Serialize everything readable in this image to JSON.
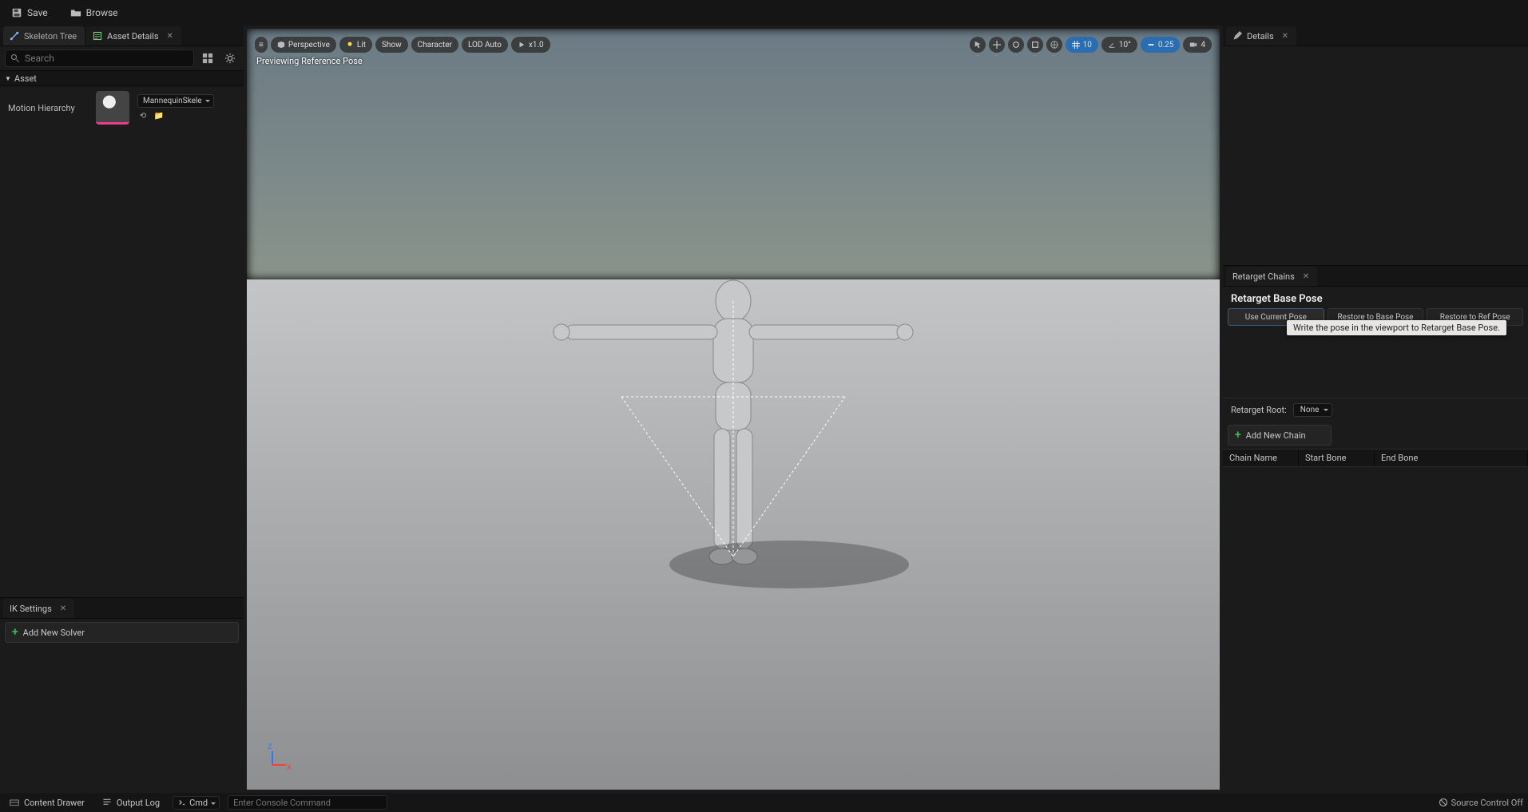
{
  "topbar": {
    "save": "Save",
    "browse": "Browse"
  },
  "left_tabs": {
    "skeleton_tree": "Skeleton Tree",
    "asset_details": "Asset Details"
  },
  "search": {
    "placeholder": "Search"
  },
  "section_asset": "Asset",
  "motion_hierarchy": {
    "label": "Motion Hierarchy",
    "asset": "MannequinSkele"
  },
  "ik_panel": {
    "tab": "IK Settings",
    "add_solver": "Add New Solver"
  },
  "viewport": {
    "overlay": "Previewing Reference Pose",
    "menu": "≡",
    "perspective": "Perspective",
    "lit": "Lit",
    "show": "Show",
    "character": "Character",
    "lod": "LOD Auto",
    "speed": "x1.0",
    "grid": "10",
    "angle": "10°",
    "scale": "0.25",
    "cam": "4",
    "axis_z": "Z",
    "axis_x": "X"
  },
  "details_tab": "Details",
  "retarget": {
    "tab": "Retarget Chains",
    "title": "Retarget Base Pose",
    "use_current": "Use Current Pose",
    "restore_base": "Restore to Base Pose",
    "restore_ref": "Restore to Ref Pose",
    "tooltip": "Write the pose in the viewport to Retarget Base Pose.",
    "root_label": "Retarget Root:",
    "root_value": "None",
    "add_chain": "Add New Chain",
    "col_chain": "Chain Name",
    "col_start": "Start Bone",
    "col_end": "End Bone"
  },
  "status": {
    "content_drawer": "Content Drawer",
    "output_log": "Output Log",
    "cmd_label": "Cmd",
    "cmd_placeholder": "Enter Console Command",
    "source_control": "Source Control Off"
  }
}
